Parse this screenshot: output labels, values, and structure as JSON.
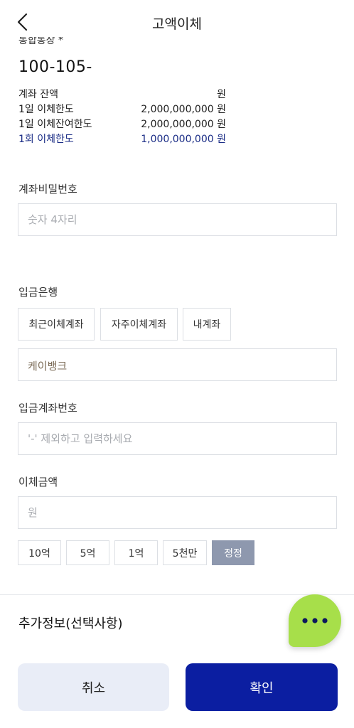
{
  "header": {
    "title": "고액이체",
    "back_icon": "chevron-left-icon"
  },
  "account": {
    "cut_text": "통합통장 *",
    "number": "100-105-",
    "rows": [
      {
        "label": "계좌 잔액",
        "value": "원"
      },
      {
        "label": "1일 이체한도",
        "value": "2,000,000,000 원"
      },
      {
        "label": "1일 이체잔여한도",
        "value": "2,000,000,000 원"
      },
      {
        "label": "1회 이체한도",
        "value": "1,000,000,000 원"
      }
    ],
    "highlight_color": "#1b2d86"
  },
  "password": {
    "label": "계좌비밀번호",
    "placeholder": "숫자 4자리"
  },
  "bank": {
    "label": "입금은행",
    "chips": [
      "최근이체계좌",
      "자주이체계좌",
      "내계좌"
    ],
    "selected": "케이뱅크"
  },
  "deposit_account": {
    "label": "입금계좌번호",
    "placeholder": "'-' 제외하고 입력하세요"
  },
  "amount": {
    "label": "이체금액",
    "placeholder": "원",
    "quick_buttons": [
      "10억",
      "5억",
      "1억",
      "5천만",
      "정정"
    ]
  },
  "extra": {
    "label": "추가정보(선택사항)"
  },
  "fab": {
    "icon": "more-dots-icon",
    "color": "#a7df4a"
  },
  "actions": {
    "cancel": "취소",
    "confirm": "확인",
    "confirm_color": "#0b1ea1"
  }
}
